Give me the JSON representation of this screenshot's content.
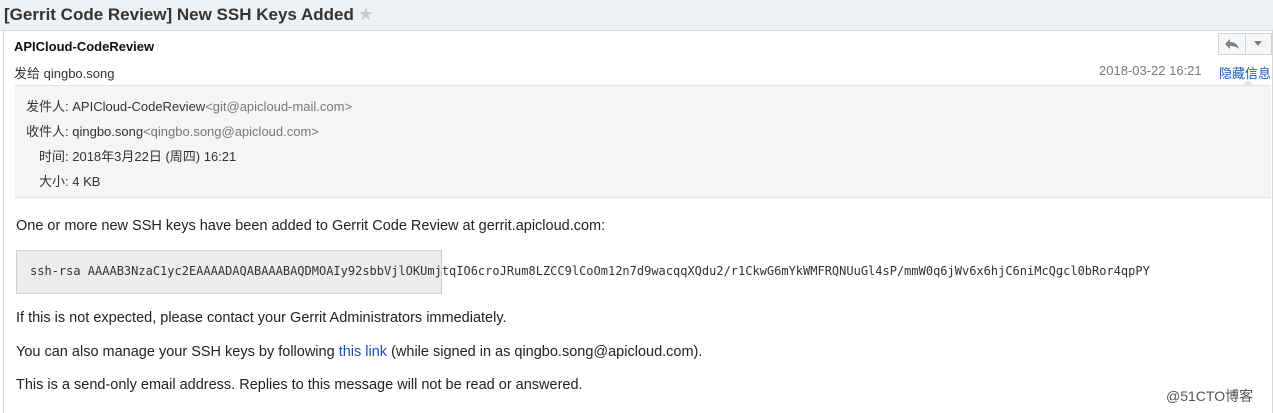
{
  "subject": "[Gerrit Code Review] New SSH Keys Added",
  "star_icon": "star-icon",
  "header": {
    "sender_name": "APICloud-CodeReview",
    "sent_to": "发给 qingbo.song",
    "datetime": "2018-03-22 16:21",
    "hide_details": "隐藏信息",
    "reply_icon": "reply-icon",
    "more_icon": "chevron-down-icon"
  },
  "details": {
    "from_label": "发件人: ",
    "from_name": "APICloud-CodeReview",
    "from_addr": "<git@apicloud-mail.com>",
    "to_label": "收件人: ",
    "to_name": "qingbo.song",
    "to_addr": "<qingbo.song@apicloud.com>",
    "time_label": "时间: ",
    "time_value": "2018年3月22日 (周四) 16:21",
    "size_label": "大小: ",
    "size_value": "4 KB"
  },
  "body": {
    "intro": "One or more new SSH keys have been added to Gerrit Code Review at gerrit.apicloud.com:",
    "ssh_key": "ssh-rsa AAAAB3NzaC1yc2EAAAADAQABAAABAQDMOAIy92sbbVjlOKUmjtqIO6croJRum8LZCC9lCoOm12n7d9wacqqXQdu2/r1CkwG6mYkWMFRQNUuGl4sP/mmW0q6jWv6x6hjC6niMcQgcl0bRor4qpPY",
    "not_expected": "If this is not expected, please contact your Gerrit Administrators immediately.",
    "manage_prefix": "You can also manage your SSH keys by following ",
    "manage_link": "this link",
    "manage_suffix": " (while signed in as qingbo.song@apicloud.com).",
    "send_only": "This is a send-only email address. Replies to this message will not be read or answered."
  },
  "watermark": "@51CTO博客"
}
